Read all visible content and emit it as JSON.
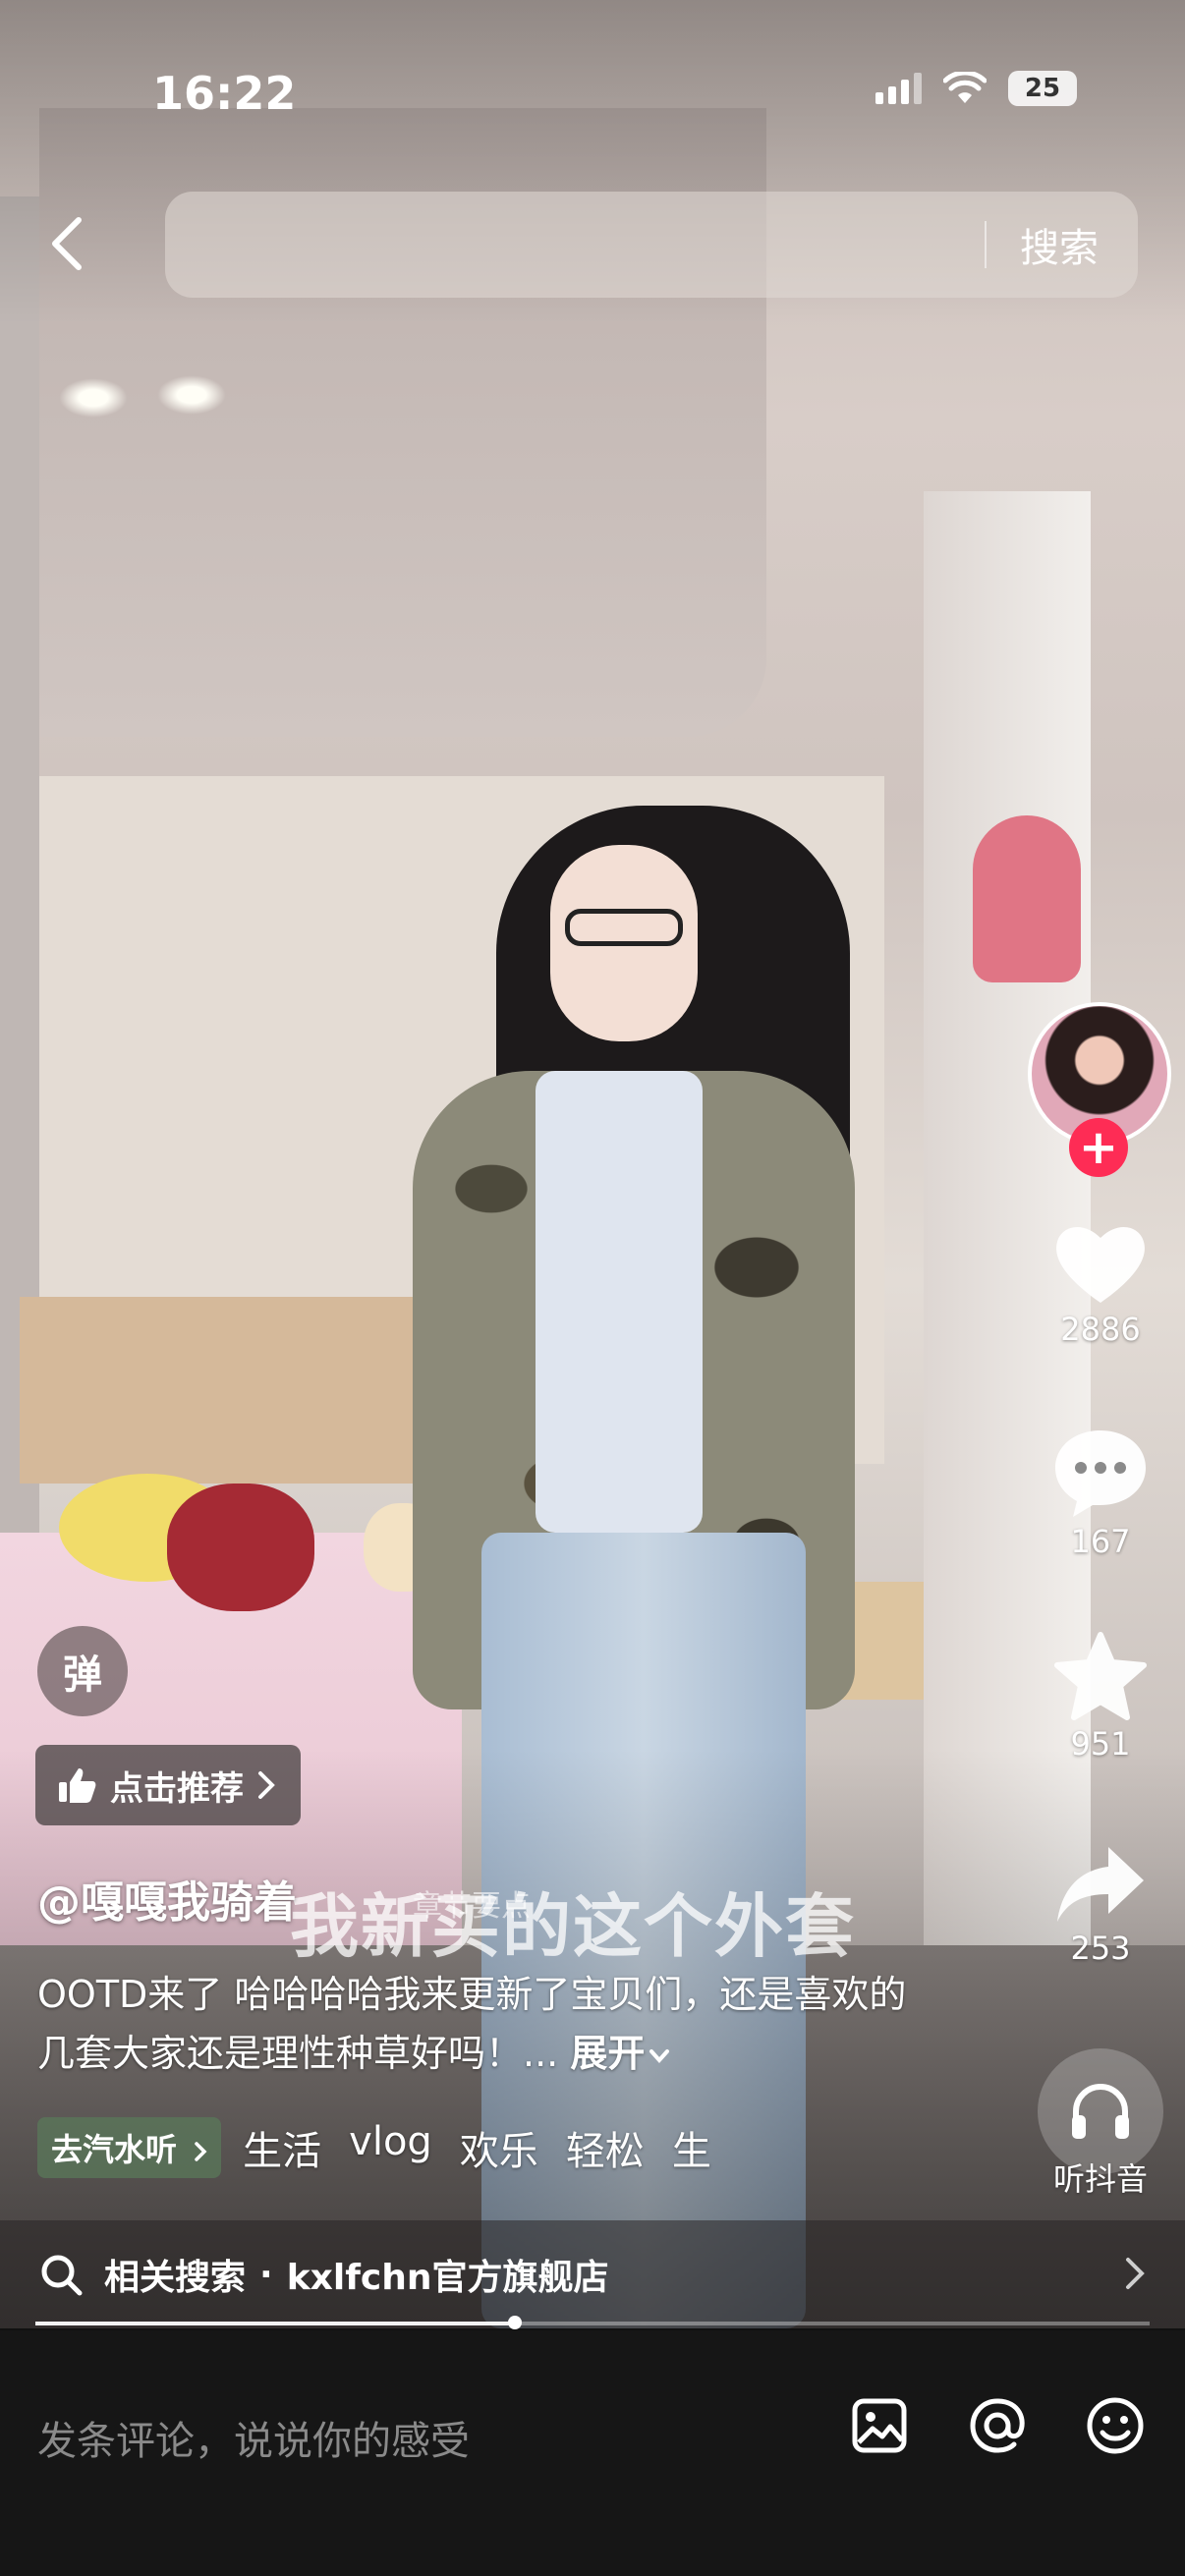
{
  "status_bar": {
    "time": "16:22",
    "battery": "25"
  },
  "top_bar": {
    "search_button": "搜索",
    "search_placeholder": ""
  },
  "actions": {
    "likes": "2886",
    "comments": "167",
    "favorites": "951",
    "shares": "253",
    "listen_label": "听抖音"
  },
  "overlay": {
    "danmu_label": "弹",
    "recommend_label": "点击推荐",
    "author": "@嘎嘎我骑着",
    "subtitle": "我新买的这个外套",
    "chapter_hint": "章节要点",
    "description": "OOTD来了 哈哈哈哈我来更新了宝贝们，还是喜欢的几套大家还是理性种草好吗！...",
    "expand_label": "展开",
    "music_pill": "去汽水听",
    "tags": [
      "生活",
      "vlog",
      "欢乐",
      "轻松",
      "生"
    ]
  },
  "related_search": {
    "label": "相关搜索",
    "separator": "·",
    "query": "kxlfchn官方旗舰店"
  },
  "progress": {
    "fraction": 0.43
  },
  "comment_bar": {
    "placeholder": "发条评论，说说你的感受"
  },
  "colors": {
    "accent_red": "#fe2c55",
    "comment_bar_bg": "#161616"
  },
  "icons": [
    "back-icon",
    "heart-icon",
    "comment-icon",
    "star-icon",
    "share-icon",
    "headphones-icon",
    "search-icon",
    "chevron-right-icon",
    "image-icon",
    "at-icon",
    "emoji-icon",
    "thumbs-up-icon"
  ]
}
